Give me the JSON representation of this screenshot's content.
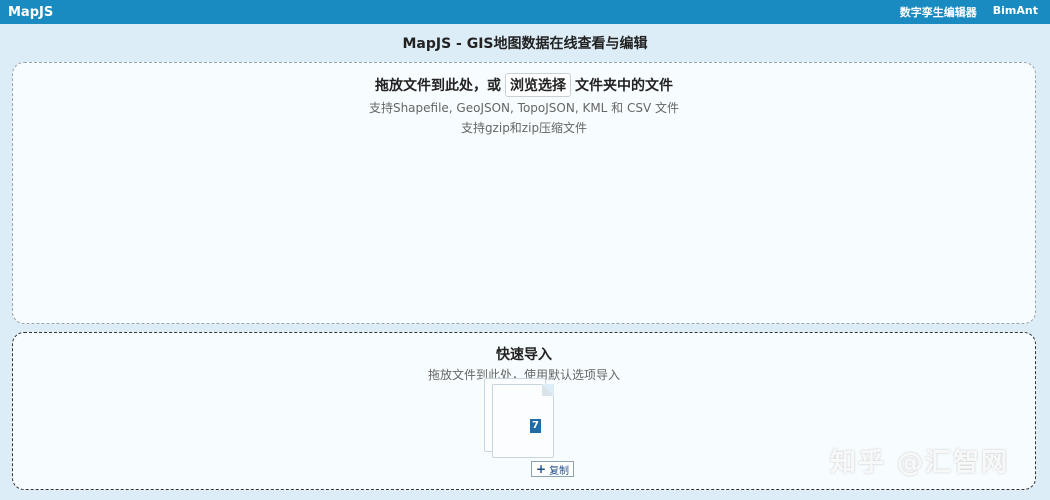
{
  "app": {
    "brand": "MapJS",
    "nav_links": [
      "数字孪生编辑器",
      "BimAnt"
    ]
  },
  "page_title": "MapJS - GIS地图数据在线查看与编辑",
  "dropzone": {
    "main_prefix": "拖放文件到此处，或",
    "browse_label": "浏览选择",
    "main_suffix": "文件夹中的文件",
    "formats": "支持Shapefile, GeoJSON, TopoJSON, KML 和 CSV 文件",
    "compressed": "支持gzip和zip压缩文件"
  },
  "quick_import": {
    "title": "快速导入",
    "subtitle": "拖放文件到此处，使用默认选项导入"
  },
  "drag_file": {
    "count": "7",
    "copy_label": "复制"
  },
  "watermark": "知乎 @汇智网",
  "colors": {
    "topbar": "#1a8bc0",
    "background": "#dcedf7"
  }
}
